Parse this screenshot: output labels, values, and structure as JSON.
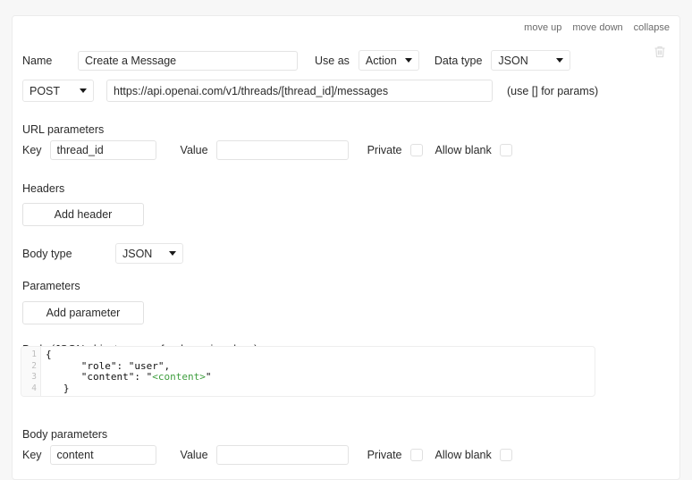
{
  "card": {
    "actions": [
      {
        "label": "move up",
        "name": "move-up-link"
      },
      {
        "label": "move down",
        "name": "move-down-link"
      },
      {
        "label": "collapse",
        "name": "collapse-link"
      }
    ],
    "delete_icon": "trash-icon"
  },
  "name_row": {
    "label": "Name",
    "value": "Create a Message",
    "placeholder": "",
    "use_as_label": "Use as",
    "use_as_value": "Action",
    "data_type_label": "Data type",
    "data_type_value": "JSON"
  },
  "url_row": {
    "method": "POST",
    "url": "https://api.openai.com/v1/threads/[thread_id]/messages",
    "url_placeholder": "",
    "hint": "(use [] for params)"
  },
  "url_parameters": {
    "title": "URL parameters",
    "key_label": "Key",
    "key_value": "thread_id",
    "value_label": "Value",
    "value_value": "",
    "value_placeholder": "",
    "private_label": "Private",
    "allow_blank_label": "Allow blank"
  },
  "headers": {
    "title": "Headers",
    "add_button": "Add header"
  },
  "body_type": {
    "label": "Body type",
    "value": "JSON"
  },
  "parameters": {
    "title": "Parameters",
    "add_button": "Add parameter"
  },
  "body": {
    "title": "Body (JSON object, use <> for dynamic values)",
    "line_numbers": [
      "1",
      "2",
      "3",
      "4"
    ],
    "lines": [
      "{",
      "      \"role\": \"user\",",
      "      \"content\": \"",
      "   }"
    ],
    "dynamic_token": "<content>",
    "dynamic_token_color": "#3f9e3f",
    "line3_tail": "\""
  },
  "body_parameters": {
    "title": "Body parameters",
    "key_label": "Key",
    "key_value": "content",
    "value_label": "Value",
    "value_value": "",
    "value_placeholder": "",
    "private_label": "Private",
    "allow_blank_label": "Allow blank"
  }
}
